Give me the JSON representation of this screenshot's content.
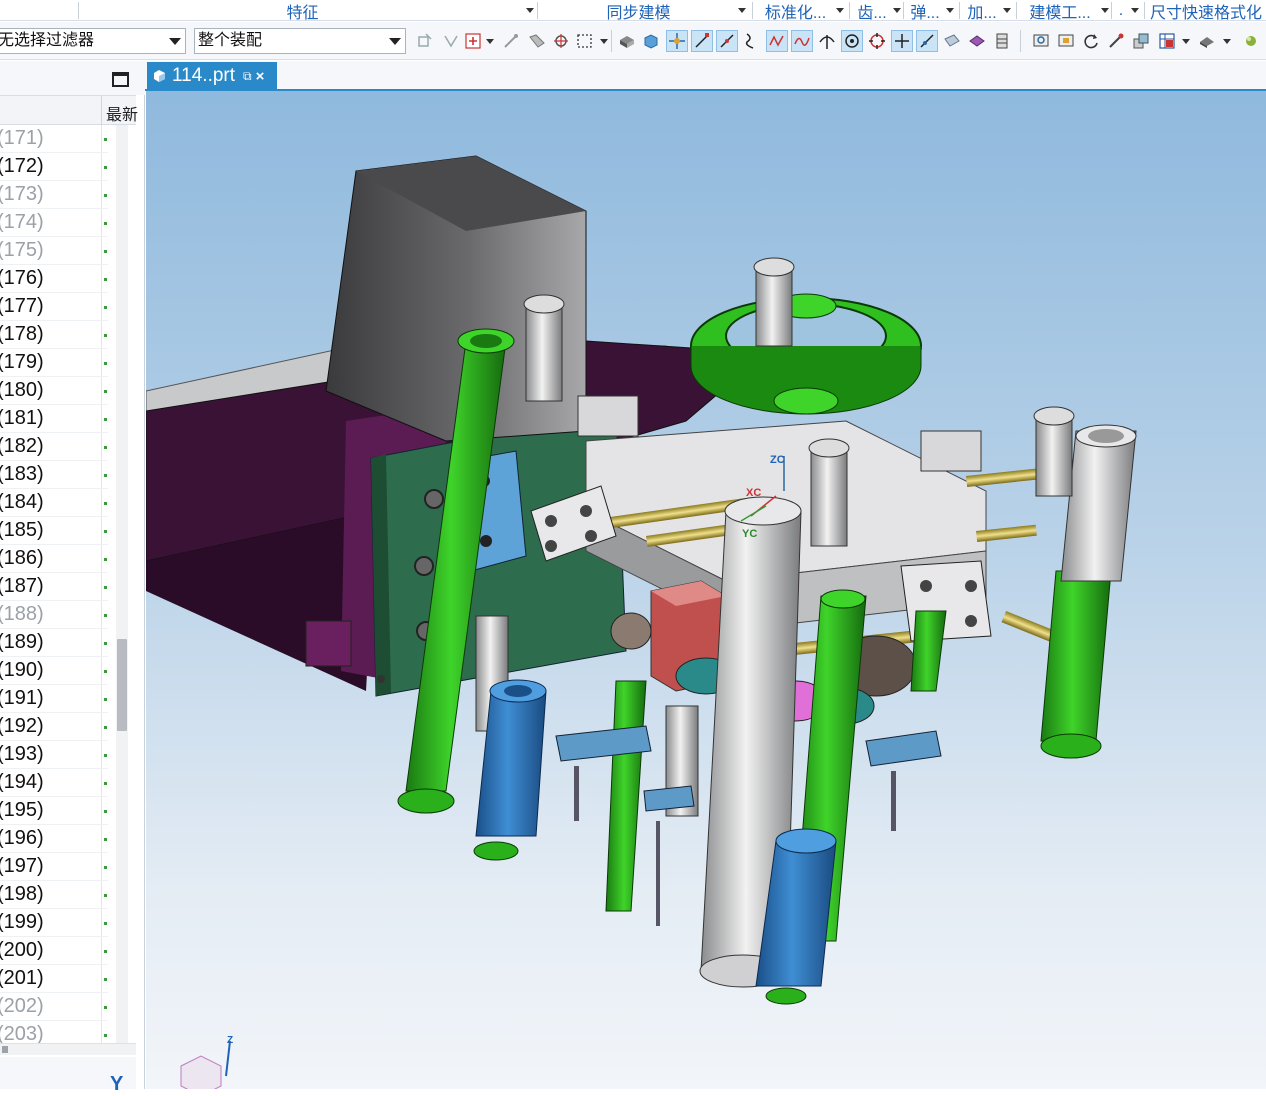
{
  "ribbon": {
    "groups": [
      {
        "label": "特征"
      },
      {
        "label": "同步建模"
      },
      {
        "label": "标准化..."
      },
      {
        "label": "齿..."
      },
      {
        "label": "弹..."
      },
      {
        "label": "加..."
      },
      {
        "label": "建模工..."
      },
      {
        "label": "尺寸快速格式化"
      }
    ]
  },
  "toolbar": {
    "selection_filter_value": "无选择过滤器",
    "scope_value": "整个装配"
  },
  "navigator": {
    "column_header_2": "最新",
    "rows": [
      {
        "label": "(171)",
        "dim": true
      },
      {
        "label": "(172)",
        "dim": false
      },
      {
        "label": "(173)",
        "dim": true
      },
      {
        "label": "(174)",
        "dim": true
      },
      {
        "label": "(175)",
        "dim": true
      },
      {
        "label": "(176)",
        "dim": false
      },
      {
        "label": "(177)",
        "dim": false
      },
      {
        "label": "(178)",
        "dim": false
      },
      {
        "label": "(179)",
        "dim": false
      },
      {
        "label": "(180)",
        "dim": false
      },
      {
        "label": "(181)",
        "dim": false
      },
      {
        "label": "(182)",
        "dim": false
      },
      {
        "label": "(183)",
        "dim": false
      },
      {
        "label": "(184)",
        "dim": false
      },
      {
        "label": "(185)",
        "dim": false
      },
      {
        "label": "(186)",
        "dim": false
      },
      {
        "label": "(187)",
        "dim": false
      },
      {
        "label": "(188)",
        "dim": true
      },
      {
        "label": "(189)",
        "dim": false
      },
      {
        "label": "(190)",
        "dim": false
      },
      {
        "label": "(191)",
        "dim": false
      },
      {
        "label": "(192)",
        "dim": false
      },
      {
        "label": "(193)",
        "dim": false
      },
      {
        "label": "(194)",
        "dim": false
      },
      {
        "label": "(195)",
        "dim": false
      },
      {
        "label": "(196)",
        "dim": false
      },
      {
        "label": "(197)",
        "dim": false
      },
      {
        "label": "(198)",
        "dim": false
      },
      {
        "label": "(199)",
        "dim": false
      },
      {
        "label": "(200)",
        "dim": false
      },
      {
        "label": "(201)",
        "dim": false
      },
      {
        "label": "(202)",
        "dim": true
      },
      {
        "label": "(203)",
        "dim": true
      }
    ],
    "bottom_letter": "Y"
  },
  "tab": {
    "title": "114..prt",
    "active_color": "#2a8ac9"
  },
  "viewport": {
    "triad_labels": {
      "z": "ZC",
      "x": "XC",
      "y": "YC"
    },
    "view_triad_z": "Z"
  },
  "colors": {
    "ribbon_text": "#1e63b8",
    "accent": "#2a8ac9",
    "part_green": "#2fbf1f",
    "part_purple": "#4e1a47",
    "part_gray": "#c9cacc",
    "part_blue": "#2f7ec4",
    "part_red": "#c0504d",
    "part_brass": "#d4c15a"
  }
}
